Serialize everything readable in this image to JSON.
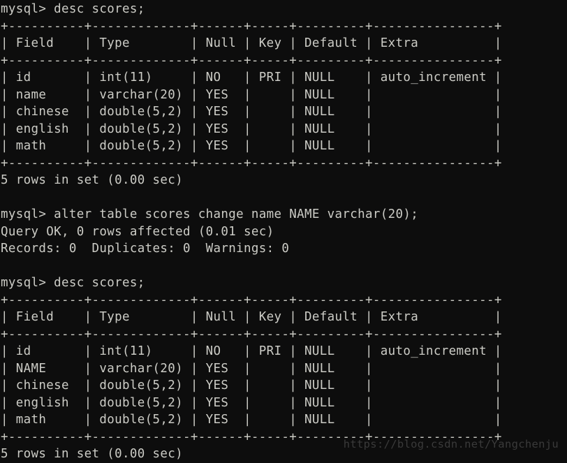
{
  "terminal": {
    "background_color": "#0d0d0d",
    "text_color": "#ccccc6",
    "prompt": "mysql>",
    "lines": [
      "mysql> desc scores;",
      "+----------+-------------+------+-----+---------+----------------+",
      "| Field    | Type        | Null | Key | Default | Extra          |",
      "+----------+-------------+------+-----+---------+----------------+",
      "| id       | int(11)     | NO   | PRI | NULL    | auto_increment |",
      "| name     | varchar(20) | YES  |     | NULL    |                |",
      "| chinese  | double(5,2) | YES  |     | NULL    |                |",
      "| english  | double(5,2) | YES  |     | NULL    |                |",
      "| math     | double(5,2) | YES  |     | NULL    |                |",
      "+----------+-------------+------+-----+---------+----------------+",
      "5 rows in set (0.00 sec)",
      "",
      "mysql> alter table scores change name NAME varchar(20);",
      "Query OK, 0 rows affected (0.01 sec)",
      "Records: 0  Duplicates: 0  Warnings: 0",
      "",
      "mysql> desc scores;",
      "+----------+-------------+------+-----+---------+----------------+",
      "| Field    | Type        | Null | Key | Default | Extra          |",
      "+----------+-------------+------+-----+---------+----------------+",
      "| id       | int(11)     | NO   | PRI | NULL    | auto_increment |",
      "| NAME     | varchar(20) | YES  |     | NULL    |                |",
      "| chinese  | double(5,2) | YES  |     | NULL    |                |",
      "| english  | double(5,2) | YES  |     | NULL    |                |",
      "| math     | double(5,2) | YES  |     | NULL    |                |",
      "+----------+-------------+------+-----+---------+----------------+",
      "5 rows in set (0.00 sec)"
    ],
    "commands": [
      "desc scores;",
      "alter table scores change name NAME varchar(20);",
      "desc scores;"
    ],
    "results": {
      "first_desc": {
        "columns": [
          "Field",
          "Type",
          "Null",
          "Key",
          "Default",
          "Extra"
        ],
        "rows": [
          [
            "id",
            "int(11)",
            "NO",
            "PRI",
            "NULL",
            "auto_increment"
          ],
          [
            "name",
            "varchar(20)",
            "YES",
            "",
            "NULL",
            ""
          ],
          [
            "chinese",
            "double(5,2)",
            "YES",
            "",
            "NULL",
            ""
          ],
          [
            "english",
            "double(5,2)",
            "YES",
            "",
            "NULL",
            ""
          ],
          [
            "math",
            "double(5,2)",
            "YES",
            "",
            "NULL",
            ""
          ]
        ],
        "footer": "5 rows in set (0.00 sec)"
      },
      "alter": {
        "status": "Query OK, 0 rows affected (0.01 sec)",
        "detail": "Records: 0  Duplicates: 0  Warnings: 0"
      },
      "second_desc": {
        "columns": [
          "Field",
          "Type",
          "Null",
          "Key",
          "Default",
          "Extra"
        ],
        "rows": [
          [
            "id",
            "int(11)",
            "NO",
            "PRI",
            "NULL",
            "auto_increment"
          ],
          [
            "NAME",
            "varchar(20)",
            "YES",
            "",
            "NULL",
            ""
          ],
          [
            "chinese",
            "double(5,2)",
            "YES",
            "",
            "NULL",
            ""
          ],
          [
            "english",
            "double(5,2)",
            "YES",
            "",
            "NULL",
            ""
          ],
          [
            "math",
            "double(5,2)",
            "YES",
            "",
            "NULL",
            ""
          ]
        ],
        "footer": "5 rows in set (0.00 sec)"
      }
    }
  },
  "watermark": {
    "text": "https://blog.csdn.net/Yangchenju",
    "color": "#3a3a3a"
  }
}
